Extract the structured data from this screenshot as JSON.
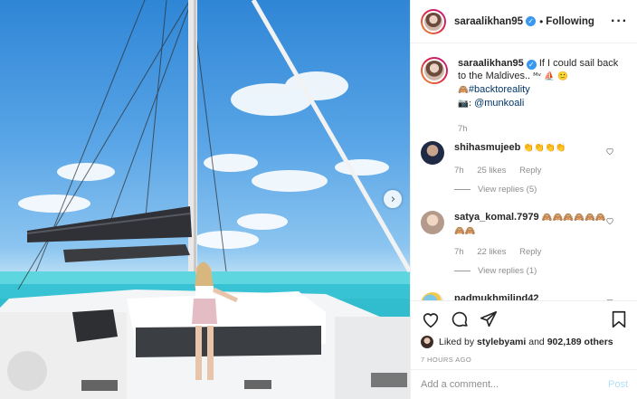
{
  "post": {
    "username": "saraalikhan95",
    "follow_status": "Following",
    "carousel_next_glyph": "›"
  },
  "caption": {
    "username": "saraalikhan95",
    "text": "If I could sail back to the Maldives.. ",
    "text_emojis": "ᴹᵛ ⛵ 🙂",
    "hashtag_prefix": "🙈",
    "hashtag": "#backtoreality",
    "mention_prefix": "📷:",
    "mention": "@munkoali",
    "time": "7h"
  },
  "comments": [
    {
      "username": "shihasmujeeb",
      "text": "👏👏👏👏",
      "time": "7h",
      "likes": "25 likes",
      "reply": "Reply",
      "view_replies": "View replies (5)"
    },
    {
      "username": "satya_komal.7979",
      "text": "🙈🙈🙈🙈🙈🙈🙈🙈",
      "time": "7h",
      "likes": "22 likes",
      "reply": "Reply",
      "view_replies": "View replies (1)"
    },
    {
      "username": "padmukhmilind42",
      "text": "♥♥♥♥♥♥♥♥♥♥"
    }
  ],
  "likes": {
    "liked_by_prefix": "Liked by",
    "liked_by_user": "stylebyami",
    "and": "and",
    "others_count": "902,189 others"
  },
  "timestamp": "7 HOURS AGO",
  "add_comment": {
    "placeholder": "Add a comment...",
    "post_label": "Post"
  },
  "colors": {
    "verified": "#3897f0",
    "link": "#003569",
    "heart_red": "#e0123a",
    "post_disabled": "#b2dffc"
  },
  "icons": [
    "verified-icon",
    "more-options-icon",
    "like-icon",
    "comment-icon",
    "share-icon",
    "save-icon",
    "heart-small-icon",
    "carousel-next-icon"
  ]
}
